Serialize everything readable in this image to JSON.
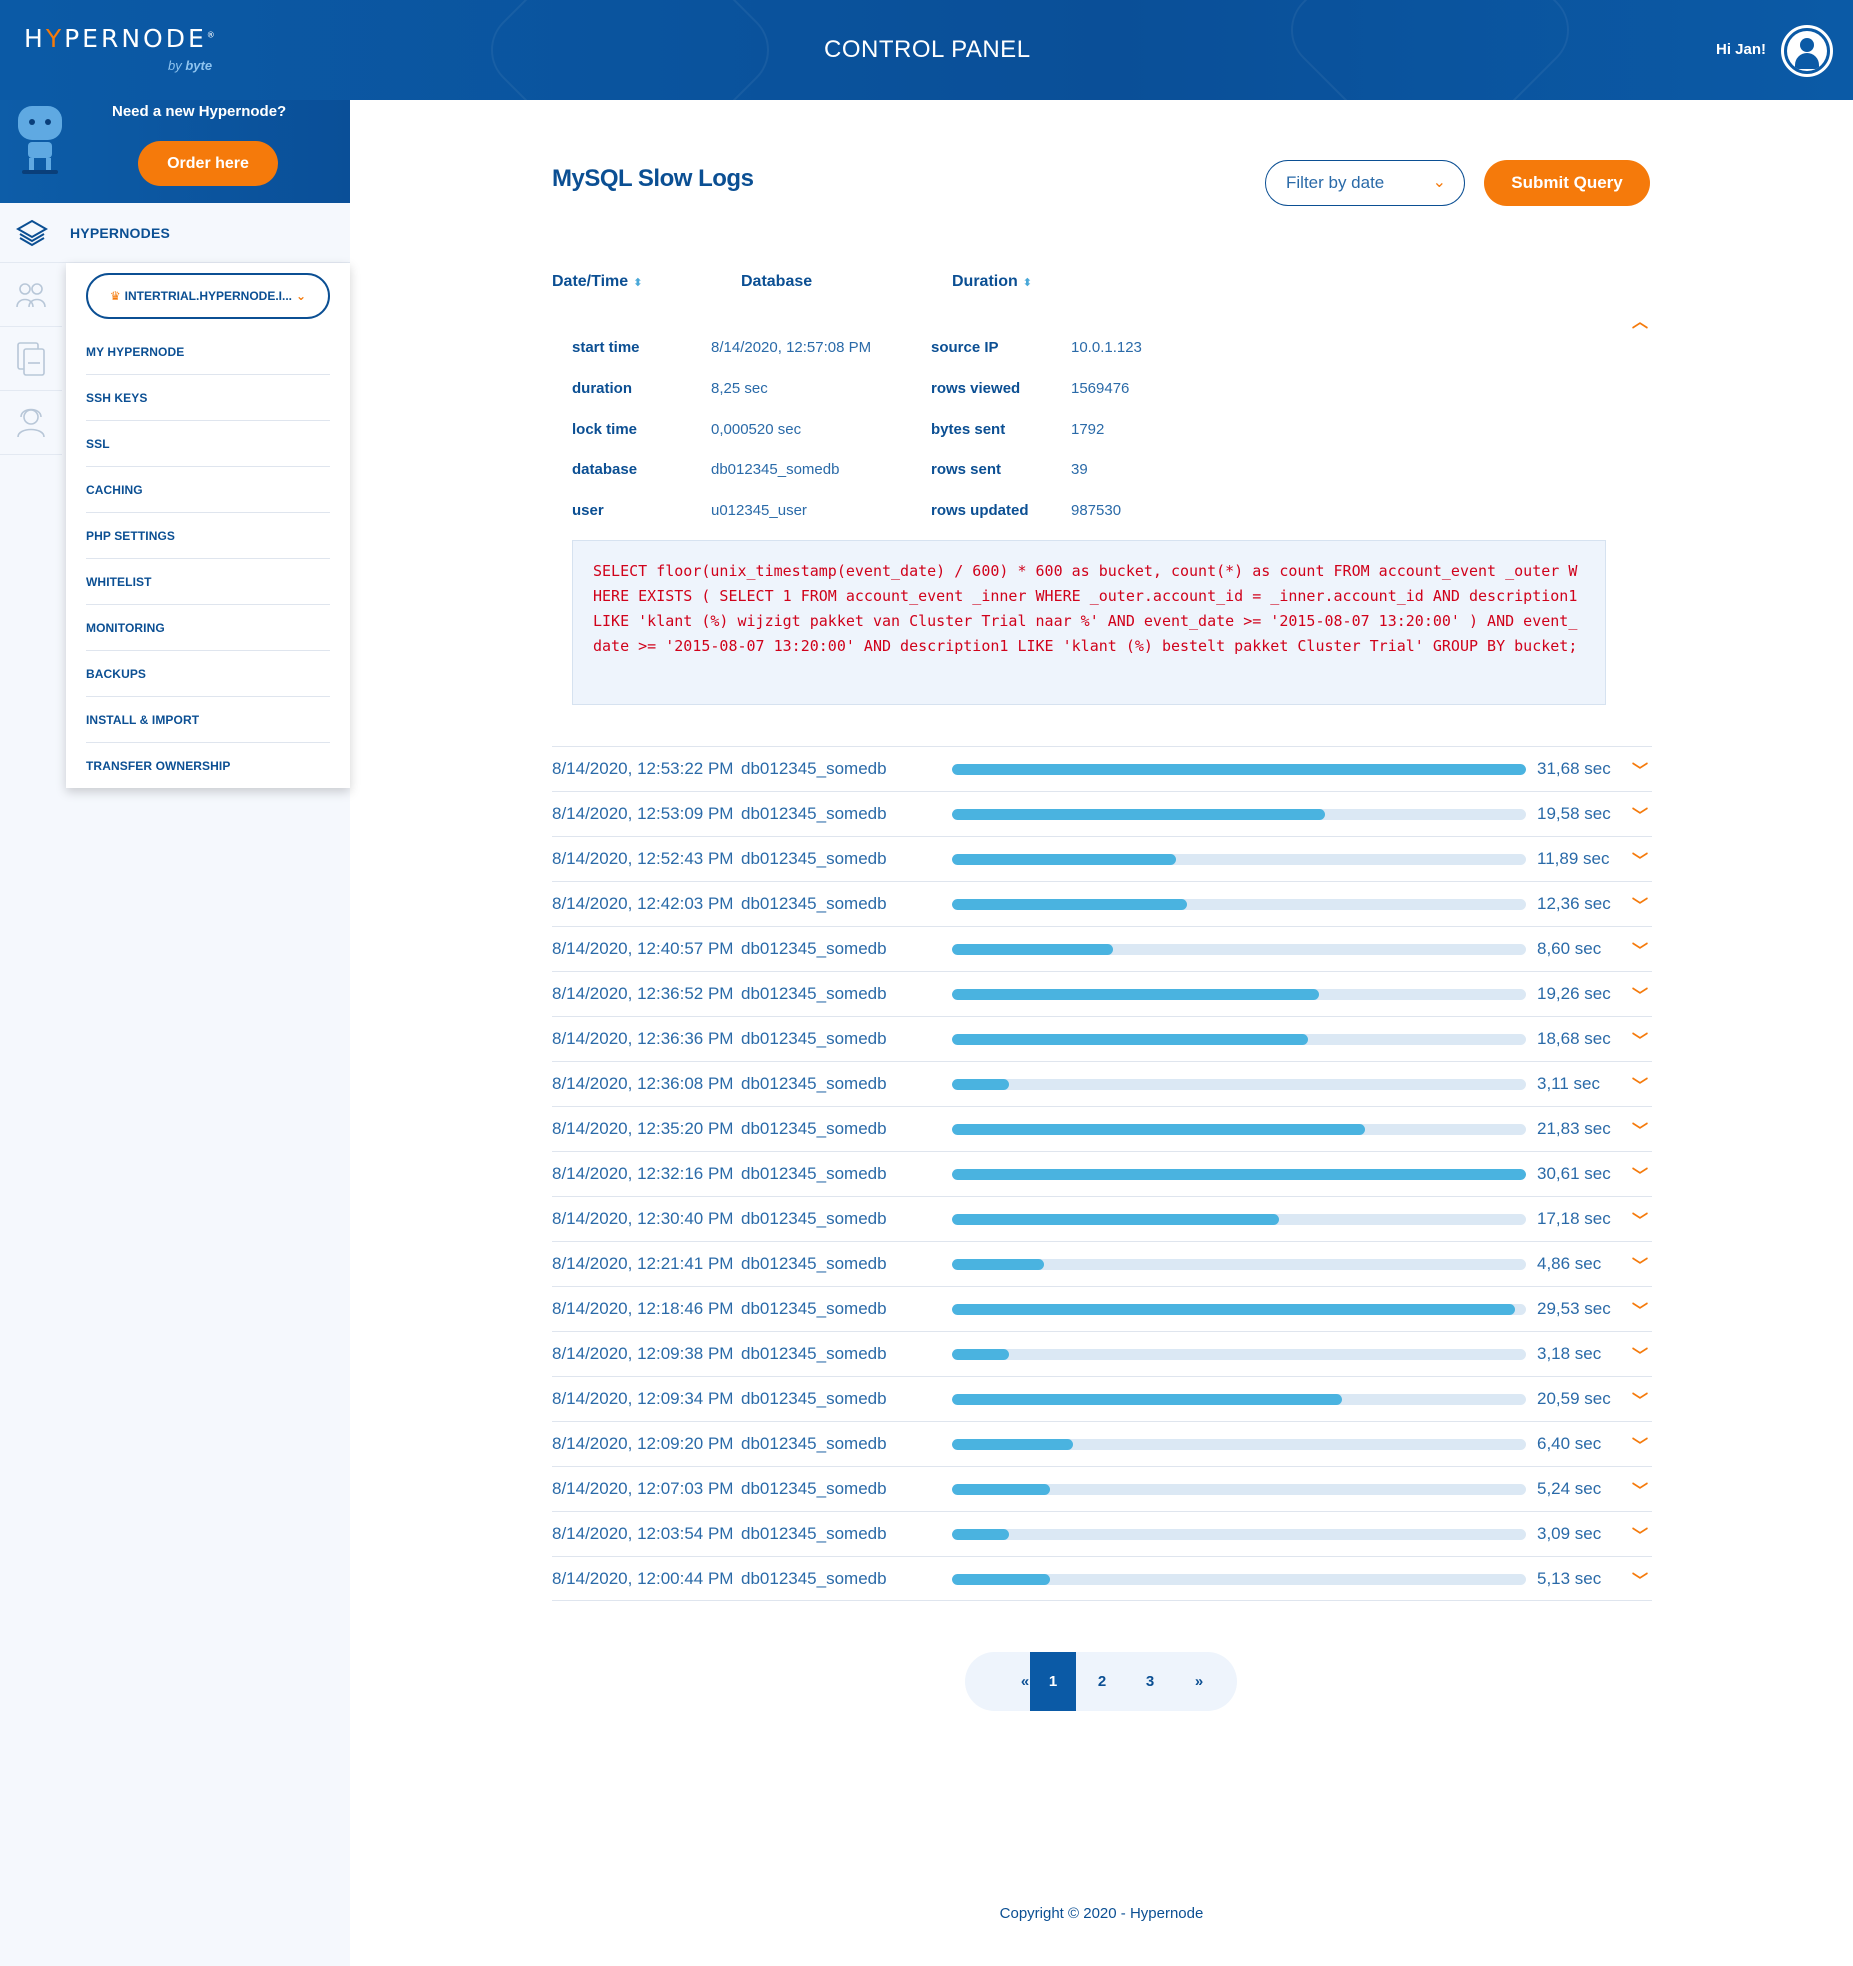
{
  "header": {
    "logo_text_a": "H",
    "logo_text_y": "Y",
    "logo_text_b": "PERNODE",
    "logo_sub_by": "by",
    "logo_sub_brand": "byte",
    "title": "CONTROL PANEL",
    "greeting": "Hi Jan!"
  },
  "promo": {
    "text": "Need a new Hypernode?",
    "button": "Order here"
  },
  "sidebar": {
    "main_item": "HYPERNODES",
    "site_selector": "INTERTRIAL.HYPERNODE.I...",
    "items": [
      "MY HYPERNODE",
      "SSH KEYS",
      "SSL",
      "CACHING",
      "PHP SETTINGS",
      "WHITELIST",
      "MONITORING",
      "BACKUPS",
      "INSTALL & IMPORT",
      "TRANSFER OWNERSHIP"
    ]
  },
  "main": {
    "title": "MySQL Slow Logs",
    "filter_placeholder": "Filter by date",
    "submit_label": "Submit Query",
    "columns": [
      "Date/Time",
      "Database",
      "Duration"
    ],
    "detail": {
      "left": [
        {
          "label": "start time",
          "value": "8/14/2020, 12:57:08 PM"
        },
        {
          "label": "duration",
          "value": "8,25 sec"
        },
        {
          "label": "lock time",
          "value": "0,000520 sec"
        },
        {
          "label": "database",
          "value": "db012345_somedb"
        },
        {
          "label": "user",
          "value": "u012345_user"
        }
      ],
      "right": [
        {
          "label": "source IP",
          "value": "10.0.1.123"
        },
        {
          "label": "rows viewed",
          "value": "1569476"
        },
        {
          "label": "bytes sent",
          "value": "1792"
        },
        {
          "label": "rows sent",
          "value": "39"
        },
        {
          "label": "rows updated",
          "value": "987530"
        }
      ],
      "query": "SELECT floor(unix_timestamp(event_date) / 600) * 600 as bucket, count(*) as count FROM account_event _outer WHERE EXISTS ( SELECT 1 FROM account_event _inner WHERE _outer.account_id = _inner.account_id AND description1 LIKE 'klant (%) wijzigt pakket van Cluster Trial naar %' AND event_date >= '2015-08-07 13:20:00' ) AND event_date >= '2015-08-07 13:20:00' AND description1 LIKE 'klant (%) bestelt pakket Cluster Trial' GROUP BY bucket;"
    },
    "rows": [
      {
        "datetime": "8/14/2020, 12:53:22 PM",
        "database": "db012345_somedb",
        "duration": "31,68 sec",
        "fraction": 1.0
      },
      {
        "datetime": "8/14/2020, 12:53:09 PM",
        "database": "db012345_somedb",
        "duration": "19,58 sec",
        "fraction": 0.65
      },
      {
        "datetime": "8/14/2020, 12:52:43 PM",
        "database": "db012345_somedb",
        "duration": "11,89 sec",
        "fraction": 0.39
      },
      {
        "datetime": "8/14/2020, 12:42:03 PM",
        "database": "db012345_somedb",
        "duration": "12,36 sec",
        "fraction": 0.41
      },
      {
        "datetime": "8/14/2020, 12:40:57 PM",
        "database": "db012345_somedb",
        "duration": "8,60 sec",
        "fraction": 0.28
      },
      {
        "datetime": "8/14/2020, 12:36:52 PM",
        "database": "db012345_somedb",
        "duration": "19,26 sec",
        "fraction": 0.64
      },
      {
        "datetime": "8/14/2020, 12:36:36 PM",
        "database": "db012345_somedb",
        "duration": "18,68 sec",
        "fraction": 0.62
      },
      {
        "datetime": "8/14/2020, 12:36:08 PM",
        "database": "db012345_somedb",
        "duration": "3,11 sec",
        "fraction": 0.1
      },
      {
        "datetime": "8/14/2020, 12:35:20 PM",
        "database": "db012345_somedb",
        "duration": "21,83 sec",
        "fraction": 0.72
      },
      {
        "datetime": "8/14/2020, 12:32:16 PM",
        "database": "db012345_somedb",
        "duration": "30,61 sec",
        "fraction": 1.0
      },
      {
        "datetime": "8/14/2020, 12:30:40 PM",
        "database": "db012345_somedb",
        "duration": "17,18 sec",
        "fraction": 0.57
      },
      {
        "datetime": "8/14/2020, 12:21:41 PM",
        "database": "db012345_somedb",
        "duration": "4,86 sec",
        "fraction": 0.16
      },
      {
        "datetime": "8/14/2020, 12:18:46 PM",
        "database": "db012345_somedb",
        "duration": "29,53 sec",
        "fraction": 0.98
      },
      {
        "datetime": "8/14/2020, 12:09:38 PM",
        "database": "db012345_somedb",
        "duration": "3,18 sec",
        "fraction": 0.1
      },
      {
        "datetime": "8/14/2020, 12:09:34 PM",
        "database": "db012345_somedb",
        "duration": "20,59 sec",
        "fraction": 0.68
      },
      {
        "datetime": "8/14/2020, 12:09:20 PM",
        "database": "db012345_somedb",
        "duration": "6,40 sec",
        "fraction": 0.21
      },
      {
        "datetime": "8/14/2020, 12:07:03 PM",
        "database": "db012345_somedb",
        "duration": "5,24 sec",
        "fraction": 0.17
      },
      {
        "datetime": "8/14/2020, 12:03:54 PM",
        "database": "db012345_somedb",
        "duration": "3,09 sec",
        "fraction": 0.1
      },
      {
        "datetime": "8/14/2020, 12:00:44 PM",
        "database": "db012345_somedb",
        "duration": "5,13 sec",
        "fraction": 0.17
      }
    ],
    "pagination": {
      "first": "«",
      "pages": [
        "1",
        "2",
        "3"
      ],
      "active": "1",
      "last": "»"
    }
  },
  "footer": "Copyright © 2020 - Hypernode",
  "colors": {
    "brand_blue": "#0b5aa6",
    "accent_orange": "#f57a0b",
    "bar_fill": "#4ab3e0",
    "bar_track": "#dbe8f4",
    "sql_text": "#d0021b"
  }
}
